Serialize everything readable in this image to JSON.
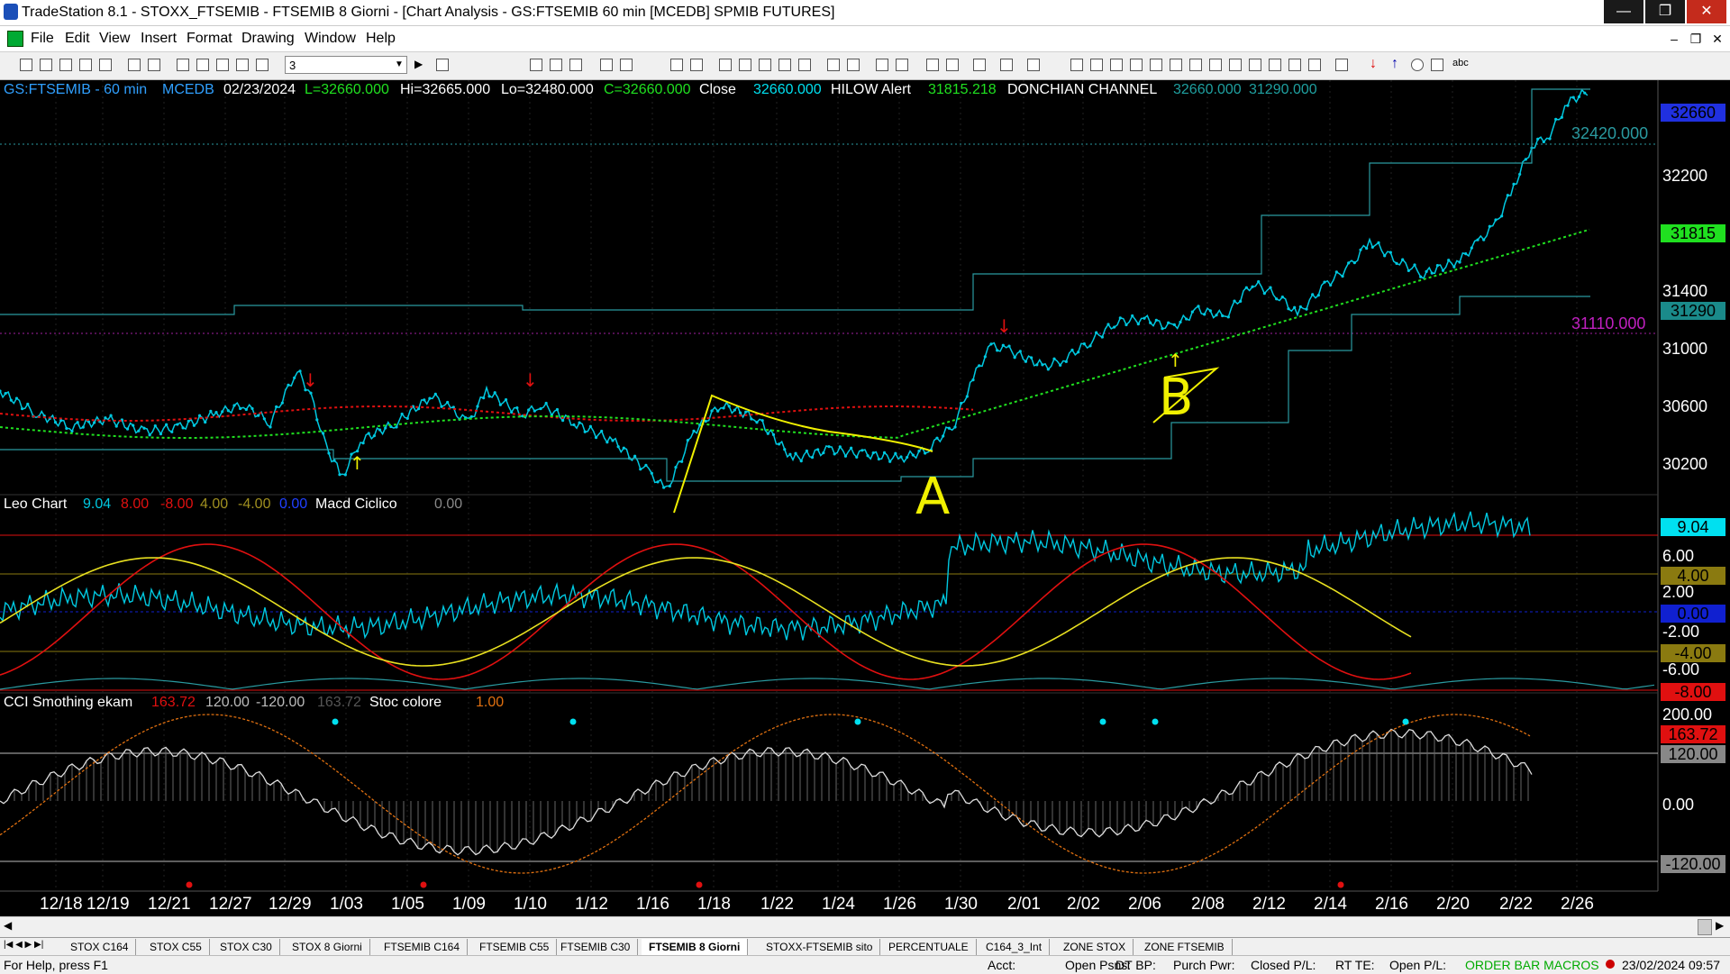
{
  "window": {
    "title": "TradeStation 8.1 - STOXX_FTSEMIB - FTSEMIB  8 Giorni - [Chart Analysis - GS:FTSEMIB  60 min  [MCEDB] SPMIB FUTURES]",
    "minimize": "—",
    "maximize": "❐",
    "close": "✕"
  },
  "menu": [
    "File",
    "Edit",
    "View",
    "Insert",
    "Format",
    "Drawing",
    "Window",
    "Help"
  ],
  "toolbar": {
    "interval_value": "3"
  },
  "header": {
    "symbol": "GS:FTSEMIB - 60 min",
    "db": "MCEDB",
    "date": "02/23/2024",
    "last": "L=32660.000",
    "high": "Hi=32665.000",
    "low": "Lo=32480.000",
    "close": "C=32660.000",
    "close_label": "Close",
    "close_value": "32660.000",
    "hilow_label": "HILOW Alert",
    "hilow_value": "31815.218",
    "donchian_label": "DONCHIAN CHANNEL",
    "donchian_hi": "32660.000",
    "donchian_lo": "31290.000"
  },
  "price_axis": [
    "32200",
    "31400",
    "31000",
    "30600",
    "30200"
  ],
  "price_markers": {
    "current": "32660",
    "level_1": "32420.000",
    "hilow": "31815",
    "donchian_low": "31290",
    "level_2": "31110.000"
  },
  "leo_panel": {
    "title": "Leo Chart",
    "v1": "9.04",
    "v2": "8.00",
    "v3": "-8.00",
    "v4": "4.00",
    "v5": "-4.00",
    "v6": "0.00",
    "macd_label": "Macd Ciclico",
    "macd_value": "0.00",
    "axis": [
      "9.04",
      "6.00",
      "4.00",
      "2.00",
      "0.00",
      "-2.00",
      "-4.00",
      "-6.00",
      "-8.00"
    ]
  },
  "cci_panel": {
    "title": "CCI Smothing ekam",
    "v1": "163.72",
    "v2": "120.00",
    "v3": "-120.00",
    "v4": "163.72",
    "stoc_label": "Stoc colore",
    "stoc_value": "1.00",
    "axis": [
      "200.00",
      "163.72",
      "120.00",
      "0.00",
      "-120.00"
    ]
  },
  "annotations": {
    "a": "A",
    "b": "B"
  },
  "x_axis": [
    "12/18",
    "12/19",
    "12/21",
    "12/27",
    "12/29",
    "1/03",
    "1/05",
    "1/09",
    "1/10",
    "1/12",
    "1/16",
    "1/18",
    "1/22",
    "1/24",
    "1/26",
    "1/30",
    "2/01",
    "2/02",
    "2/06",
    "2/08",
    "2/12",
    "2/14",
    "2/16",
    "2/20",
    "2/22",
    "2/26"
  ],
  "tabs": [
    "STOX C164",
    "STOX C55",
    "STOX  C30",
    "STOX  8 Giorni",
    "FTSEMIB C164",
    "FTSEMIB C55",
    "FTSEMIB C30",
    "FTSEMIB  8 Giorni",
    "STOXX-FTSEMIB sito",
    "PERCENTUALE",
    "C164_3_Int",
    "ZONE STOX",
    "ZONE FTSEMIB"
  ],
  "active_tab": "FTSEMIB  8 Giorni",
  "status": {
    "help": "For Help, press F1",
    "acct": "Acct:",
    "open_psns": "Open Psns:",
    "dt_bp": "DT BP:",
    "purch_pwr": "Purch Pwr:",
    "closed_pl": "Closed P/L:",
    "rt_te": "RT TE:",
    "open_pl": "Open P/L:",
    "order_bar": "ORDER BAR  MACROS",
    "datetime": "23/02/2024 09:57"
  },
  "colors": {
    "price_line": "#00c8e0",
    "red_ma": "#e01010",
    "green_ma": "#20e020",
    "channel": "#2a9aa0",
    "yellow": "#f0f000",
    "hilow_box": "#20e020",
    "donchian_box": "#1fa0a0"
  }
}
